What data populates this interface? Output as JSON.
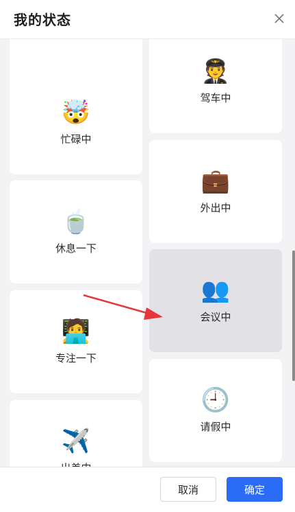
{
  "header": {
    "title": "我的状态"
  },
  "icons": {
    "close": "close-icon"
  },
  "cards": {
    "top_left": {
      "label": "",
      "emoji": ""
    },
    "driving": {
      "label": "驾车中",
      "emoji": "🧑‍✈️"
    },
    "busy": {
      "label": "忙碌中",
      "emoji": "🤯"
    },
    "out": {
      "label": "外出中",
      "emoji": "💼"
    },
    "rest": {
      "label": "休息一下",
      "emoji": "🍵"
    },
    "meeting": {
      "label": "会议中",
      "emoji": "👥"
    },
    "focus": {
      "label": "专注一下",
      "emoji": "🧑‍💻"
    },
    "leave": {
      "label": "请假中",
      "emoji": "🕘"
    },
    "trip": {
      "label": "出差中",
      "emoji": "✈️"
    }
  },
  "footer": {
    "cancel_label": "取消",
    "ok_label": "确定"
  },
  "colors": {
    "primary": "#2a6cf6",
    "arrow": "#e5383b",
    "card_active": "#e2e2e6"
  }
}
